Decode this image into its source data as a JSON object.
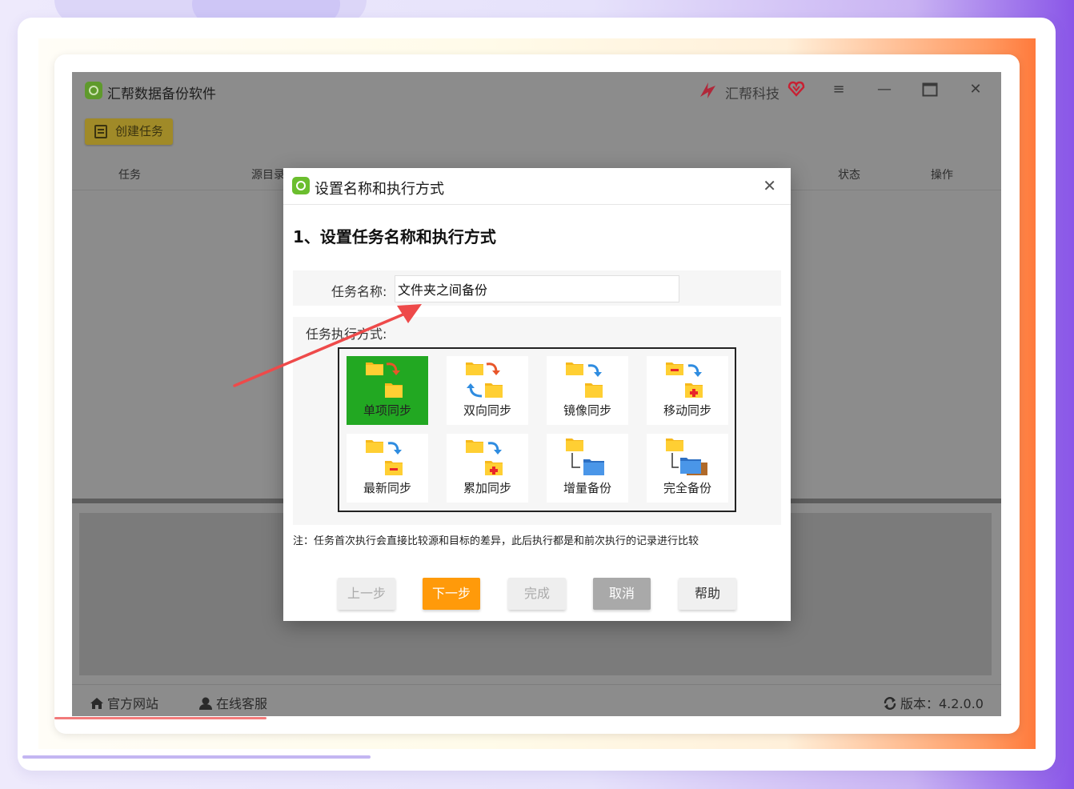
{
  "app": {
    "title": "汇帮数据备份软件",
    "brand": "汇帮科技",
    "create_task_label": "创建任务",
    "columns": [
      "任务",
      "源目录",
      "状态",
      "操作"
    ],
    "footer": {
      "website_label": "官方网站",
      "support_label": "在线客服",
      "version_label": "版本：4.2.0.0"
    }
  },
  "dialog": {
    "title": "设置名称和执行方式",
    "step_title": "1、设置任务名称和执行方式",
    "task_name_label": "任务名称:",
    "task_name_value": "文件夹之间备份",
    "mode_label": "任务执行方式:",
    "modes": [
      {
        "label": "单项同步",
        "icon": "one-way-sync-icon",
        "selected": true
      },
      {
        "label": "双向同步",
        "icon": "two-way-sync-icon",
        "selected": false
      },
      {
        "label": "镜像同步",
        "icon": "mirror-sync-icon",
        "selected": false
      },
      {
        "label": "移动同步",
        "icon": "move-sync-icon",
        "selected": false
      },
      {
        "label": "最新同步",
        "icon": "latest-sync-icon",
        "selected": false
      },
      {
        "label": "累加同步",
        "icon": "cumulative-sync-icon",
        "selected": false
      },
      {
        "label": "增量备份",
        "icon": "incremental-backup-icon",
        "selected": false
      },
      {
        "label": "完全备份",
        "icon": "full-backup-icon",
        "selected": false
      }
    ],
    "note": "注：任务首次执行会直接比较源和目标的差异，此后执行都是和前次执行的记录进行比较",
    "buttons": {
      "prev": "上一步",
      "next": "下一步",
      "finish": "完成",
      "cancel": "取消",
      "help": "帮助"
    }
  },
  "colors": {
    "selected_tile": "#22a822",
    "next_button": "#ff9a0a",
    "annotation_arrow": "#ee4a4a"
  }
}
